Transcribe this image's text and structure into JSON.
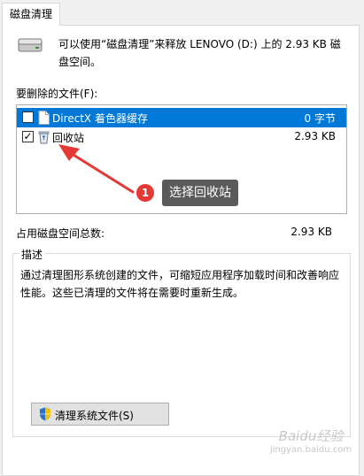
{
  "tab": {
    "label": "磁盘清理"
  },
  "intro": {
    "text": "可以使用“磁盘清理”来释放 LENOVO (D:) 上的 2.93 KB 磁盘空间。"
  },
  "files": {
    "label": "要删除的文件(F):",
    "items": [
      {
        "name": "DirectX 着色器缓存",
        "size": "0 字节",
        "checked": false,
        "selected": true,
        "icon": "file-icon"
      },
      {
        "name": "回收站",
        "size": "2.93 KB",
        "checked": true,
        "selected": false,
        "icon": "recycle-bin-icon"
      }
    ]
  },
  "total": {
    "label": "占用磁盘空间总数:",
    "value": "2.93 KB"
  },
  "description": {
    "title": "描述",
    "text": "通过清理图形系统创建的文件，可缩短应用程序加载时间和改善响应性能。这些已清理的文件将在需要时重新生成。"
  },
  "buttons": {
    "clean_system_files": "清理系统文件(S)"
  },
  "annotation": {
    "step_number": "1",
    "text": "选择回收站"
  },
  "watermark": {
    "text": "Baidu经验",
    "sub": "jingyan.baidu.com"
  },
  "colors": {
    "selection": "#0078d7",
    "badge": "#e53935",
    "arrow": "#e53935",
    "callout": "#5a5a5a"
  }
}
